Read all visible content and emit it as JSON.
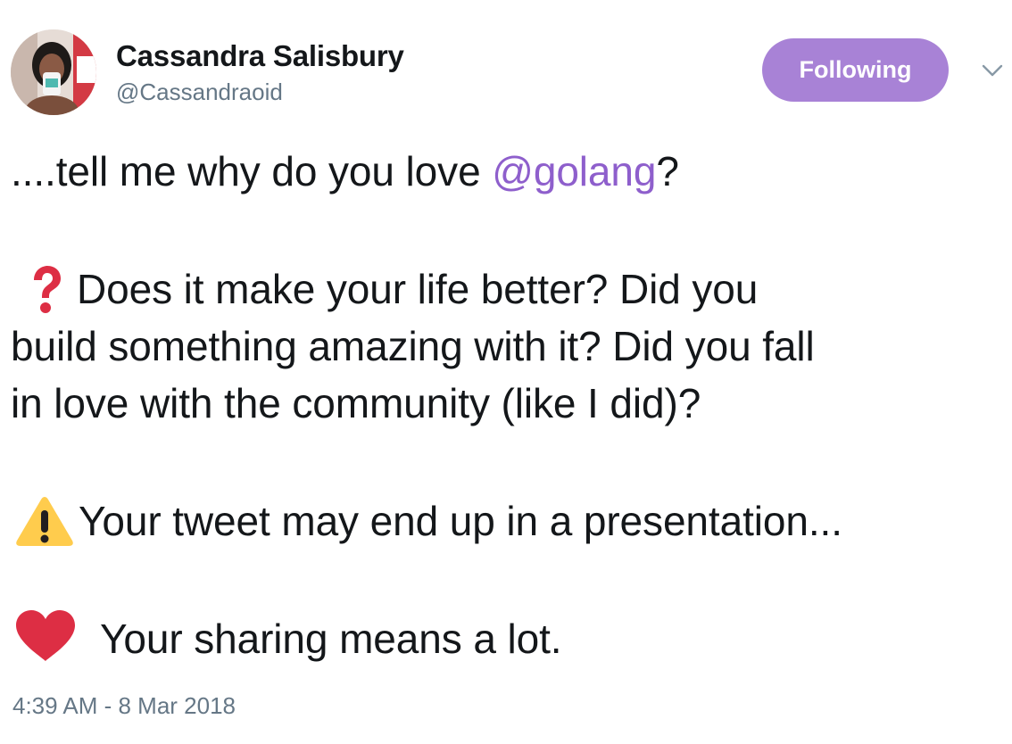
{
  "author": {
    "display_name": "Cassandra Salisbury",
    "handle": "@Cassandraoid",
    "avatar_icon": "profile-photo"
  },
  "follow_button": {
    "label": "Following",
    "color": "#a882d6"
  },
  "menu": {
    "icon": "chevron-down-icon"
  },
  "tweet": {
    "line1_prefix": "....tell me why do you love ",
    "mention": "@golang",
    "line1_suffix": "?",
    "para2_line1": "Does it make your life better? Did you",
    "para2_line2": "build something amazing with it? Did you fall",
    "para2_line3": "in love with the community (like I did)?",
    "para3": "Your tweet may end up in a presentation...",
    "para4": "Your sharing means a lot.",
    "emoji_1": "question-mark-emoji",
    "emoji_2": "warning-emoji",
    "emoji_3": "red-heart-emoji",
    "mention_color": "#8e5fcc"
  },
  "timestamp": "4:39 AM - 8 Mar 2018"
}
